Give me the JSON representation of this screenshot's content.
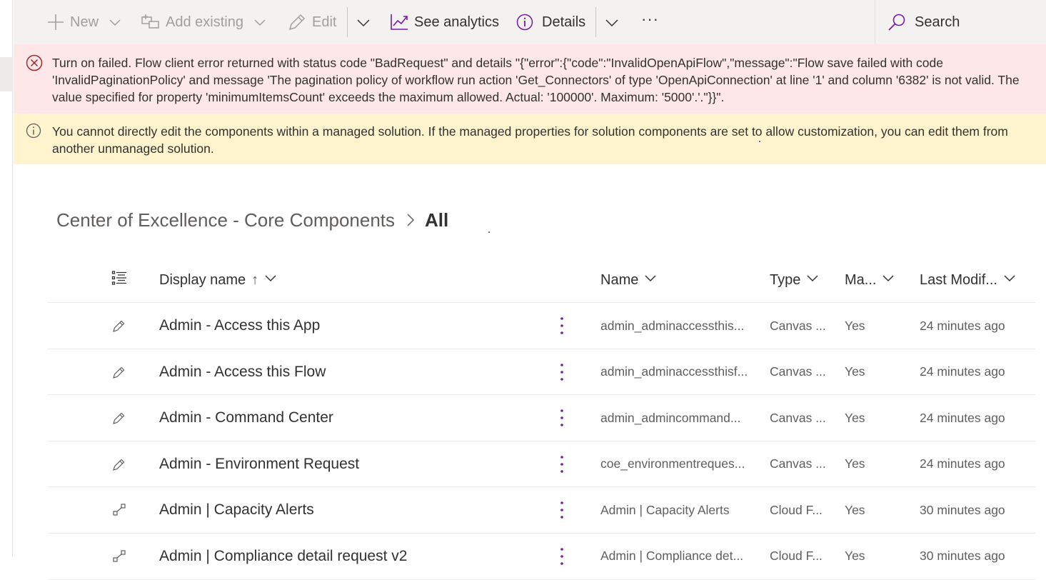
{
  "colors": {
    "accent": "#7719aa",
    "error_bg": "#fde7e9",
    "error_icon": "#a4262c",
    "warning_bg": "#fff4ce",
    "command_bar_bg": "#f3f2f1"
  },
  "toolbar": {
    "new_label": "New",
    "add_existing_label": "Add existing",
    "edit_label": "Edit",
    "see_analytics_label": "See analytics",
    "details_label": "Details",
    "more_label": "···",
    "search_label": "Search"
  },
  "error_bar": {
    "icon": "error-circle-icon",
    "text": "Turn on failed. Flow client error returned with status code \"BadRequest\" and details \"{\"error\":{\"code\":\"InvalidOpenApiFlow\",\"message\":\"Flow save failed with code 'InvalidPaginationPolicy' and message 'The pagination policy of workflow run action 'Get_Connectors' of type 'OpenApiConnection' at line '1' and column '6382' is not valid. The value specified for property 'minimumItemsCount' exceeds the maximum allowed. Actual: '100000'. Maximum: '5000'.'.\"}}\"."
  },
  "warning_bar": {
    "icon": "info-icon",
    "text": "You cannot directly edit the components within a managed solution. If the managed properties for solution components are set to allow customization, you can edit them from another unmanaged solution."
  },
  "breadcrumb": {
    "parent": "Center of Excellence - Core Components",
    "current": "All"
  },
  "table": {
    "columns": {
      "display_name": "Display name",
      "display_name_sort": "↑",
      "name": "Name",
      "type": "Type",
      "managed": "Ma...",
      "last_modified": "Last Modif..."
    },
    "rows": [
      {
        "icon": "pencil-icon",
        "display_name": "Admin - Access this App",
        "name": "admin_adminaccessthis...",
        "type": "Canvas ...",
        "managed": "Yes",
        "modified": "24 minutes ago"
      },
      {
        "icon": "pencil-icon",
        "display_name": "Admin - Access this Flow",
        "name": "admin_adminaccessthisf...",
        "type": "Canvas ...",
        "managed": "Yes",
        "modified": "24 minutes ago"
      },
      {
        "icon": "pencil-icon",
        "display_name": "Admin - Command Center",
        "name": "admin_admincommand...",
        "type": "Canvas ...",
        "managed": "Yes",
        "modified": "24 minutes ago"
      },
      {
        "icon": "pencil-icon",
        "display_name": "Admin - Environment Request",
        "name": "coe_environmentreques...",
        "type": "Canvas ...",
        "managed": "Yes",
        "modified": "24 minutes ago"
      },
      {
        "icon": "flow-icon",
        "display_name": "Admin | Capacity Alerts",
        "name": "Admin | Capacity Alerts",
        "type": "Cloud F...",
        "managed": "Yes",
        "modified": "30 minutes ago"
      },
      {
        "icon": "flow-icon",
        "display_name": "Admin | Compliance detail request v2",
        "name": "Admin | Compliance det...",
        "type": "Cloud F...",
        "managed": "Yes",
        "modified": "30 minutes ago"
      }
    ]
  }
}
